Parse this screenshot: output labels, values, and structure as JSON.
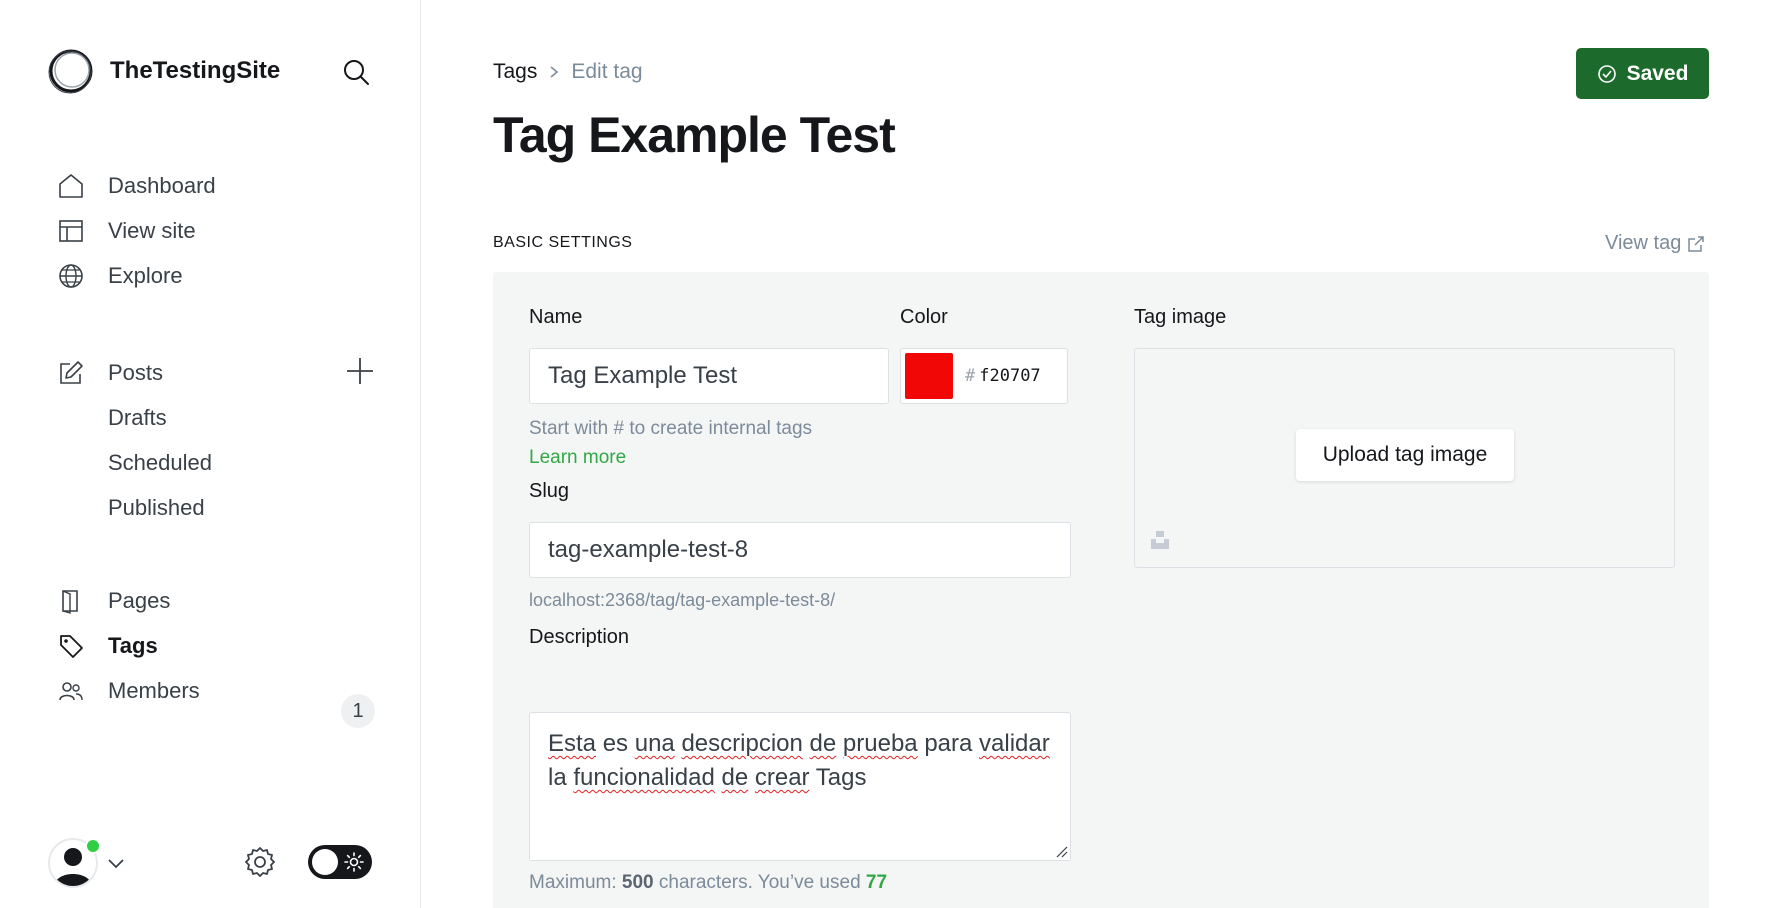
{
  "brand": {
    "name": "TheTestingSite"
  },
  "sidebar": {
    "nav": [
      {
        "label": "Dashboard",
        "icon": "home-icon"
      },
      {
        "label": "View site",
        "icon": "layout-icon"
      },
      {
        "label": "Explore",
        "icon": "globe-icon"
      }
    ],
    "posts": {
      "label": "Posts",
      "icon": "pencil-icon"
    },
    "post_subs": [
      {
        "label": "Drafts"
      },
      {
        "label": "Scheduled"
      },
      {
        "label": "Published"
      }
    ],
    "bottom_nav": [
      {
        "label": "Pages",
        "icon": "page-icon"
      },
      {
        "label": "Tags",
        "icon": "tag-icon",
        "active": true
      },
      {
        "label": "Members",
        "icon": "users-icon",
        "badge": "1"
      }
    ]
  },
  "breadcrumb": {
    "parent": "Tags",
    "current": "Edit tag"
  },
  "page_title": "Tag Example Test",
  "save_button": {
    "label": "Saved",
    "color": "#1c6b2c"
  },
  "section": {
    "title": "BASIC SETTINGS",
    "view_link": "View tag"
  },
  "form": {
    "name": {
      "label": "Name",
      "value": "Tag Example Test",
      "hint": "Start with # to create internal tags",
      "learn_more": "Learn more"
    },
    "color": {
      "label": "Color",
      "hash": "#",
      "value": "f20707",
      "swatch": "#f20707"
    },
    "slug": {
      "label": "Slug",
      "value": "tag-example-test-8",
      "url": "localhost:2368/tag/tag-example-test-8/"
    },
    "description": {
      "label": "Description",
      "words": [
        "Esta",
        "es",
        "una",
        "descripcion",
        "de",
        "prueba",
        "para",
        "validar",
        "la",
        "funcionalidad",
        "de",
        "crear",
        "Tags"
      ],
      "counter_prefix": "Maximum:",
      "max": "500",
      "counter_mid": "characters. You’ve used",
      "used": "77"
    },
    "tag_image": {
      "label": "Tag image",
      "upload_label": "Upload tag image"
    }
  }
}
